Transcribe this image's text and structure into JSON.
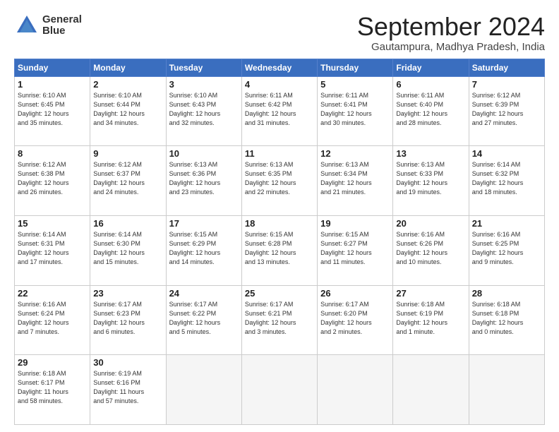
{
  "header": {
    "logo_line1": "General",
    "logo_line2": "Blue",
    "month": "September 2024",
    "location": "Gautampura, Madhya Pradesh, India"
  },
  "weekdays": [
    "Sunday",
    "Monday",
    "Tuesday",
    "Wednesday",
    "Thursday",
    "Friday",
    "Saturday"
  ],
  "weeks": [
    [
      {
        "day": "1",
        "info": "Sunrise: 6:10 AM\nSunset: 6:45 PM\nDaylight: 12 hours\nand 35 minutes."
      },
      {
        "day": "2",
        "info": "Sunrise: 6:10 AM\nSunset: 6:44 PM\nDaylight: 12 hours\nand 34 minutes."
      },
      {
        "day": "3",
        "info": "Sunrise: 6:10 AM\nSunset: 6:43 PM\nDaylight: 12 hours\nand 32 minutes."
      },
      {
        "day": "4",
        "info": "Sunrise: 6:11 AM\nSunset: 6:42 PM\nDaylight: 12 hours\nand 31 minutes."
      },
      {
        "day": "5",
        "info": "Sunrise: 6:11 AM\nSunset: 6:41 PM\nDaylight: 12 hours\nand 30 minutes."
      },
      {
        "day": "6",
        "info": "Sunrise: 6:11 AM\nSunset: 6:40 PM\nDaylight: 12 hours\nand 28 minutes."
      },
      {
        "day": "7",
        "info": "Sunrise: 6:12 AM\nSunset: 6:39 PM\nDaylight: 12 hours\nand 27 minutes."
      }
    ],
    [
      {
        "day": "8",
        "info": "Sunrise: 6:12 AM\nSunset: 6:38 PM\nDaylight: 12 hours\nand 26 minutes."
      },
      {
        "day": "9",
        "info": "Sunrise: 6:12 AM\nSunset: 6:37 PM\nDaylight: 12 hours\nand 24 minutes."
      },
      {
        "day": "10",
        "info": "Sunrise: 6:13 AM\nSunset: 6:36 PM\nDaylight: 12 hours\nand 23 minutes."
      },
      {
        "day": "11",
        "info": "Sunrise: 6:13 AM\nSunset: 6:35 PM\nDaylight: 12 hours\nand 22 minutes."
      },
      {
        "day": "12",
        "info": "Sunrise: 6:13 AM\nSunset: 6:34 PM\nDaylight: 12 hours\nand 21 minutes."
      },
      {
        "day": "13",
        "info": "Sunrise: 6:13 AM\nSunset: 6:33 PM\nDaylight: 12 hours\nand 19 minutes."
      },
      {
        "day": "14",
        "info": "Sunrise: 6:14 AM\nSunset: 6:32 PM\nDaylight: 12 hours\nand 18 minutes."
      }
    ],
    [
      {
        "day": "15",
        "info": "Sunrise: 6:14 AM\nSunset: 6:31 PM\nDaylight: 12 hours\nand 17 minutes."
      },
      {
        "day": "16",
        "info": "Sunrise: 6:14 AM\nSunset: 6:30 PM\nDaylight: 12 hours\nand 15 minutes."
      },
      {
        "day": "17",
        "info": "Sunrise: 6:15 AM\nSunset: 6:29 PM\nDaylight: 12 hours\nand 14 minutes."
      },
      {
        "day": "18",
        "info": "Sunrise: 6:15 AM\nSunset: 6:28 PM\nDaylight: 12 hours\nand 13 minutes."
      },
      {
        "day": "19",
        "info": "Sunrise: 6:15 AM\nSunset: 6:27 PM\nDaylight: 12 hours\nand 11 minutes."
      },
      {
        "day": "20",
        "info": "Sunrise: 6:16 AM\nSunset: 6:26 PM\nDaylight: 12 hours\nand 10 minutes."
      },
      {
        "day": "21",
        "info": "Sunrise: 6:16 AM\nSunset: 6:25 PM\nDaylight: 12 hours\nand 9 minutes."
      }
    ],
    [
      {
        "day": "22",
        "info": "Sunrise: 6:16 AM\nSunset: 6:24 PM\nDaylight: 12 hours\nand 7 minutes."
      },
      {
        "day": "23",
        "info": "Sunrise: 6:17 AM\nSunset: 6:23 PM\nDaylight: 12 hours\nand 6 minutes."
      },
      {
        "day": "24",
        "info": "Sunrise: 6:17 AM\nSunset: 6:22 PM\nDaylight: 12 hours\nand 5 minutes."
      },
      {
        "day": "25",
        "info": "Sunrise: 6:17 AM\nSunset: 6:21 PM\nDaylight: 12 hours\nand 3 minutes."
      },
      {
        "day": "26",
        "info": "Sunrise: 6:17 AM\nSunset: 6:20 PM\nDaylight: 12 hours\nand 2 minutes."
      },
      {
        "day": "27",
        "info": "Sunrise: 6:18 AM\nSunset: 6:19 PM\nDaylight: 12 hours\nand 1 minute."
      },
      {
        "day": "28",
        "info": "Sunrise: 6:18 AM\nSunset: 6:18 PM\nDaylight: 12 hours\nand 0 minutes."
      }
    ],
    [
      {
        "day": "29",
        "info": "Sunrise: 6:18 AM\nSunset: 6:17 PM\nDaylight: 11 hours\nand 58 minutes."
      },
      {
        "day": "30",
        "info": "Sunrise: 6:19 AM\nSunset: 6:16 PM\nDaylight: 11 hours\nand 57 minutes."
      },
      {
        "day": "",
        "info": ""
      },
      {
        "day": "",
        "info": ""
      },
      {
        "day": "",
        "info": ""
      },
      {
        "day": "",
        "info": ""
      },
      {
        "day": "",
        "info": ""
      }
    ]
  ]
}
